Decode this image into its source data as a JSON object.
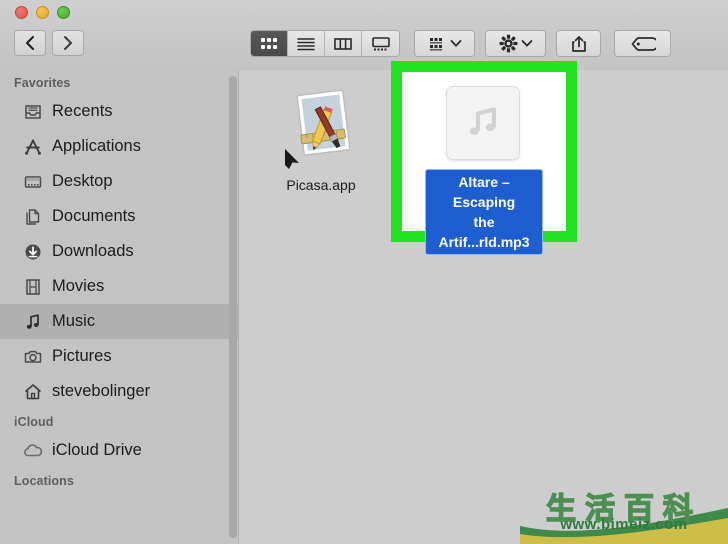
{
  "window": {
    "traffic_lights": {
      "close_label": "Close",
      "minimize_label": "Minimize",
      "maximize_label": "Maximize"
    },
    "nav": {
      "back_label": "Back",
      "forward_label": "Forward"
    }
  },
  "toolbar": {
    "view_buttons": [
      {
        "name": "icon-view",
        "label": "Icon View",
        "active": true
      },
      {
        "name": "list-view",
        "label": "List View",
        "active": false
      },
      {
        "name": "column-view",
        "label": "Column View",
        "active": false
      },
      {
        "name": "gallery-view",
        "label": "Gallery View",
        "active": false
      }
    ],
    "arrange_label": "Arrange By",
    "action_label": "Action",
    "share_label": "Share",
    "tags_label": "Tags"
  },
  "sidebar": {
    "sections": [
      {
        "title": "Favorites",
        "items": [
          {
            "label": "Recents",
            "icon": "recents-icon",
            "selected": false
          },
          {
            "label": "Applications",
            "icon": "applications-icon",
            "selected": false
          },
          {
            "label": "Desktop",
            "icon": "desktop-icon",
            "selected": false
          },
          {
            "label": "Documents",
            "icon": "documents-icon",
            "selected": false
          },
          {
            "label": "Downloads",
            "icon": "downloads-icon",
            "selected": false
          },
          {
            "label": "Movies",
            "icon": "movies-icon",
            "selected": false
          },
          {
            "label": "Music",
            "icon": "music-icon",
            "selected": true
          },
          {
            "label": "Pictures",
            "icon": "pictures-icon",
            "selected": false
          },
          {
            "label": "stevebolinger",
            "icon": "home-icon",
            "selected": false
          }
        ]
      },
      {
        "title": "iCloud",
        "items": [
          {
            "label": "iCloud Drive",
            "icon": "icloud-icon",
            "selected": false
          }
        ]
      },
      {
        "title": "Locations",
        "items": []
      }
    ]
  },
  "content": {
    "files": [
      {
        "name": "Picasa.app",
        "kind": "application-alias",
        "selected": false
      },
      {
        "name_line1": "Altare – Escaping",
        "name_line2": "the Artif...rld.mp3",
        "kind": "audio-mp3",
        "selected": true
      }
    ]
  },
  "annotation": {
    "highlight_color": "#22e222",
    "highlight_target": "Altare – Escaping the Artif...rld.mp3"
  },
  "watermark": {
    "cn_text": "生活百科",
    "url": "www.bimeiz.com"
  },
  "colors": {
    "selection_blue": "#1d5fd0",
    "sidebar_bg": "#c3c3c3",
    "content_bg": "#cdcdcd",
    "toolbar_bg": "#c9c9c9"
  }
}
